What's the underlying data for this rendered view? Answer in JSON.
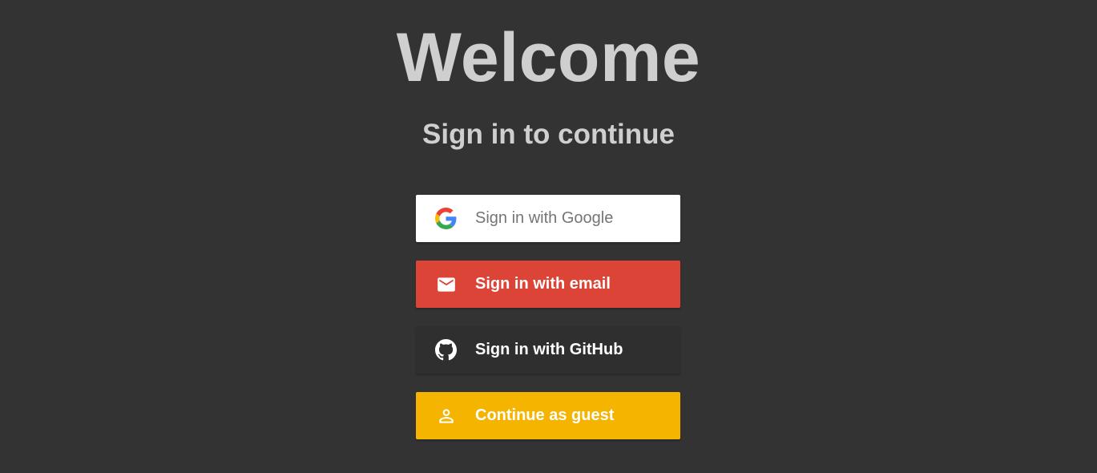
{
  "heading": {
    "title": "Welcome",
    "subtitle": "Sign in to continue"
  },
  "buttons": [
    {
      "label": "Sign in with Google",
      "icon": "google-icon",
      "background": "#ffffff",
      "text_color": "#757575"
    },
    {
      "label": "Sign in with email",
      "icon": "mail-icon",
      "background": "#db4437",
      "text_color": "#ffffff"
    },
    {
      "label": "Sign in with GitHub",
      "icon": "github-icon",
      "background": "#2f2f2f",
      "text_color": "#ffffff"
    },
    {
      "label": "Continue as guest",
      "icon": "person-icon",
      "background": "#f4b400",
      "text_color": "#ffffff"
    }
  ],
  "colors": {
    "page_background": "#333333",
    "heading_text": "#cfcfcf"
  }
}
